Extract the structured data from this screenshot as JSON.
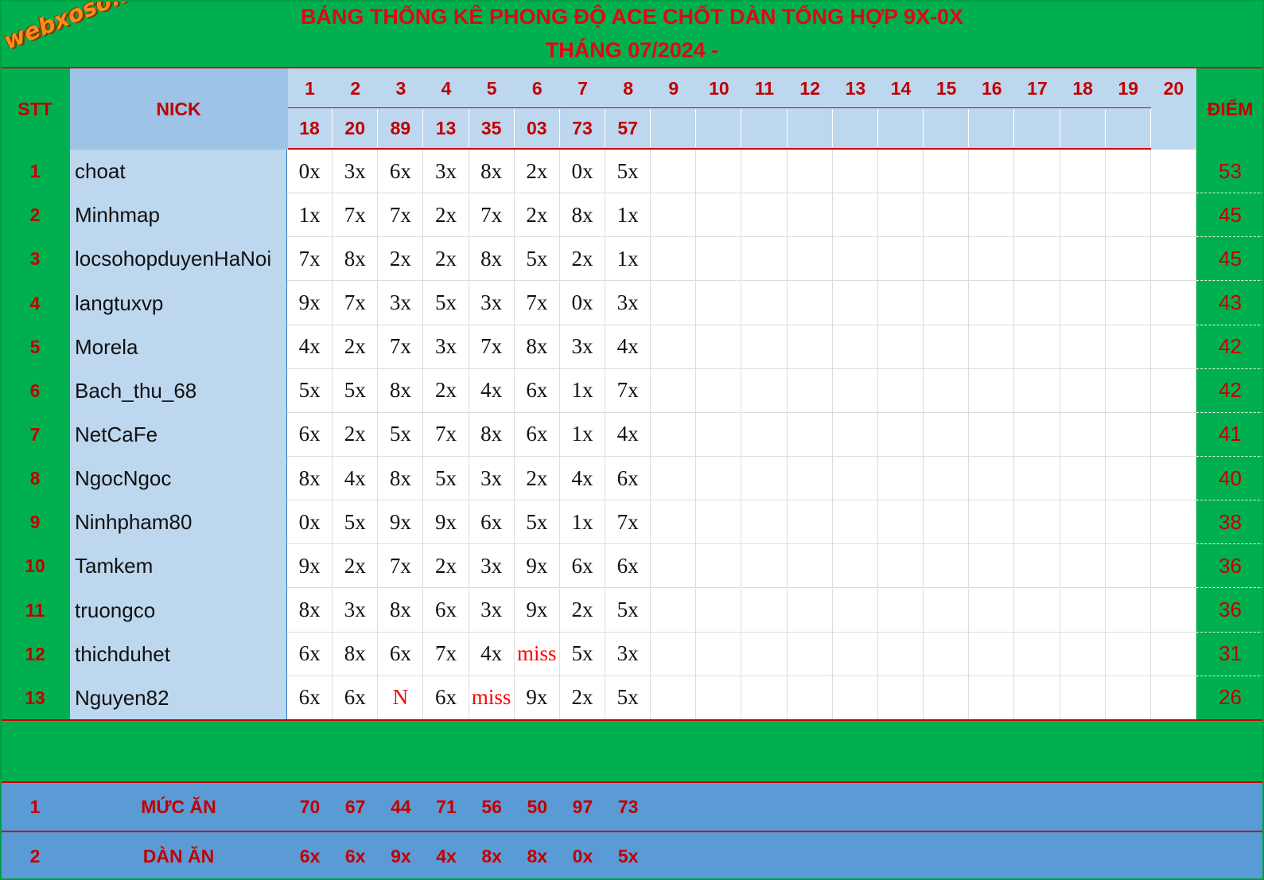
{
  "logo": {
    "text": "webxoso.net"
  },
  "title": {
    "line1": "BẢNG THỐNG KÊ PHONG ĐỘ ACE CHỐT DÀN TỔNG HỢP 9X-0X",
    "line2": "THÁNG 07/2024 -"
  },
  "header": {
    "stt": "STT",
    "nick": "NICK",
    "score": "ĐIỂM",
    "days": [
      "1",
      "2",
      "3",
      "4",
      "5",
      "6",
      "7",
      "8",
      "9",
      "10",
      "11",
      "12",
      "13",
      "14",
      "15",
      "16",
      "17",
      "18",
      "19",
      "20"
    ],
    "results": [
      "18",
      "20",
      "89",
      "13",
      "35",
      "03",
      "73",
      "57",
      "",
      "",
      "",
      "",
      "",
      "",
      "",
      "",
      "",
      "",
      "",
      ""
    ]
  },
  "rows": [
    {
      "stt": "1",
      "nick": "choat",
      "picks": [
        "0x",
        "3x",
        "6x",
        "3x",
        "8x",
        "2x",
        "0x",
        "5x"
      ],
      "score": "53"
    },
    {
      "stt": "2",
      "nick": "Minhmap",
      "picks": [
        "1x",
        "7x",
        "7x",
        "2x",
        "7x",
        "2x",
        "8x",
        "1x"
      ],
      "score": "45"
    },
    {
      "stt": "3",
      "nick": "locsohopduyenHaNoi",
      "picks": [
        "7x",
        "8x",
        "2x",
        "2x",
        "8x",
        "5x",
        "2x",
        "1x"
      ],
      "score": "45"
    },
    {
      "stt": "4",
      "nick": "langtuxvp",
      "picks": [
        "9x",
        "7x",
        "3x",
        "5x",
        "3x",
        "7x",
        "0x",
        "3x"
      ],
      "score": "43"
    },
    {
      "stt": "5",
      "nick": "Morela",
      "picks": [
        "4x",
        "2x",
        "7x",
        "3x",
        "7x",
        "8x",
        "3x",
        "4x"
      ],
      "score": "42"
    },
    {
      "stt": "6",
      "nick": "Bach_thu_68",
      "picks": [
        "5x",
        "5x",
        "8x",
        "2x",
        "4x",
        "6x",
        "1x",
        "7x"
      ],
      "score": "42"
    },
    {
      "stt": "7",
      "nick": "NetCaFe",
      "picks": [
        "6x",
        "2x",
        "5x",
        "7x",
        "8x",
        "6x",
        "1x",
        "4x"
      ],
      "score": "41"
    },
    {
      "stt": "8",
      "nick": "NgocNgoc",
      "picks": [
        "8x",
        "4x",
        "8x",
        "5x",
        "3x",
        "2x",
        "4x",
        "6x"
      ],
      "score": "40"
    },
    {
      "stt": "9",
      "nick": "Ninhpham80",
      "picks": [
        "0x",
        "5x",
        "9x",
        "9x",
        "6x",
        "5x",
        "1x",
        "7x"
      ],
      "score": "38"
    },
    {
      "stt": "10",
      "nick": "Tamkem",
      "picks": [
        "9x",
        "2x",
        "7x",
        "2x",
        "3x",
        "9x",
        "6x",
        "6x"
      ],
      "score": "36"
    },
    {
      "stt": "11",
      "nick": "truongco",
      "picks": [
        "8x",
        "3x",
        "8x",
        "6x",
        "3x",
        "9x",
        "2x",
        "5x"
      ],
      "score": "36"
    },
    {
      "stt": "12",
      "nick": "thichduhet",
      "picks": [
        "6x",
        "8x",
        "6x",
        "7x",
        "4x",
        "miss",
        "5x",
        "3x"
      ],
      "score": "31"
    },
    {
      "stt": "13",
      "nick": "Nguyen82",
      "picks": [
        "6x",
        "6x",
        "N",
        "6x",
        "miss",
        "9x",
        "2x",
        "5x"
      ],
      "score": "26"
    }
  ],
  "footer": [
    {
      "stt": "1",
      "label": "MỨC ĂN",
      "values": [
        "70",
        "67",
        "44",
        "71",
        "56",
        "50",
        "97",
        "73"
      ]
    },
    {
      "stt": "2",
      "label": "DÀN ĂN",
      "values": [
        "6x",
        "6x",
        "9x",
        "4x",
        "8x",
        "8x",
        "0x",
        "5x"
      ]
    }
  ],
  "colors": {
    "green": "#00b050",
    "nick_bg": "#bdd7ee",
    "header_blue": "#9dc3e6",
    "footer_blue": "#5b9bd5",
    "red": "#c00000"
  }
}
